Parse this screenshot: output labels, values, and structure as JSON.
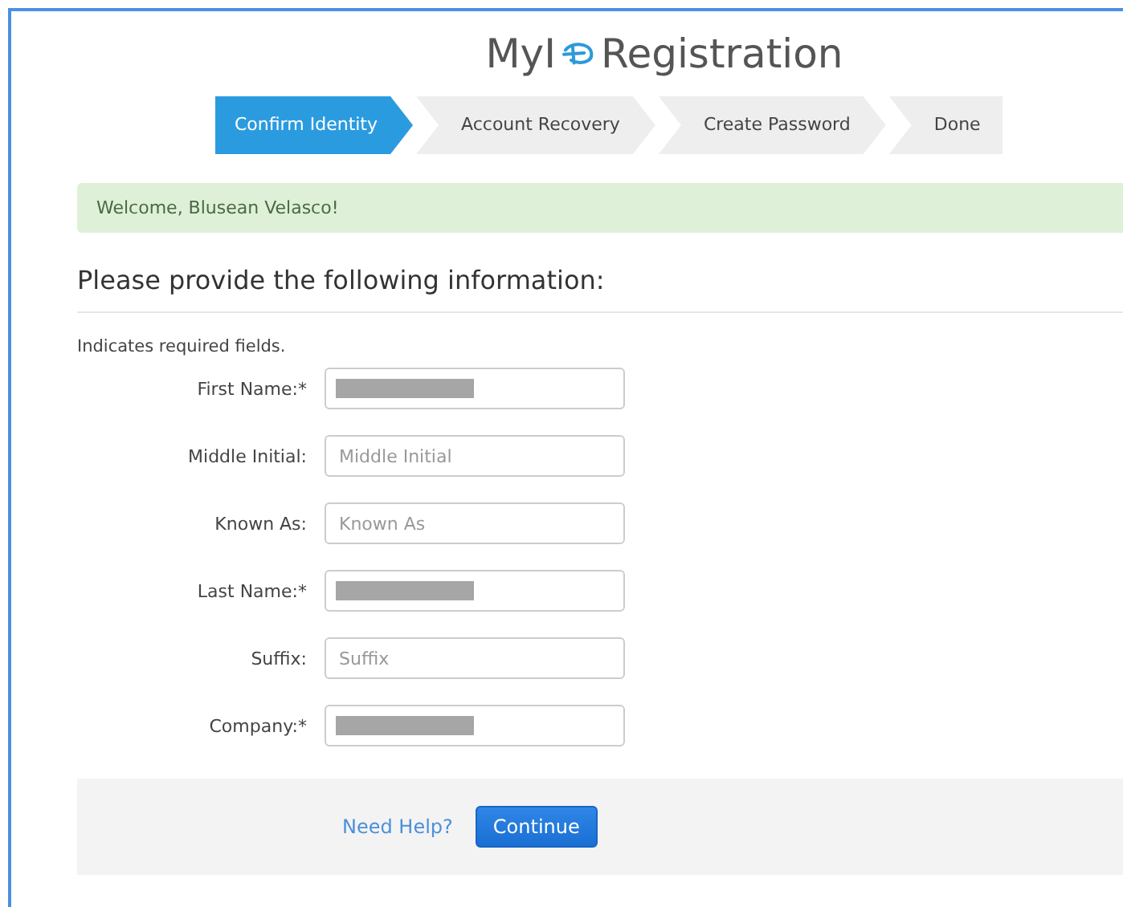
{
  "header": {
    "title_prefix": "MyI",
    "title_suffix": "Registration"
  },
  "steps": [
    {
      "label": "Confirm Identity",
      "selected": true
    },
    {
      "label": "Account Recovery",
      "selected": false
    },
    {
      "label": "Create Password",
      "selected": false
    },
    {
      "label": "Done",
      "selected": false
    }
  ],
  "alert": {
    "text": "Welcome, Blusean Velasco!"
  },
  "form": {
    "heading": "Please provide the following information:",
    "note": "Indicates required fields.",
    "fields": [
      {
        "label": "First Name:*",
        "kind": "redacted"
      },
      {
        "label": "Middle Initial:",
        "kind": "empty",
        "placeholder": "Middle Initial"
      },
      {
        "label": "Known As:",
        "kind": "empty",
        "placeholder": "Known As"
      },
      {
        "label": "Last Name:*",
        "kind": "redacted"
      },
      {
        "label": "Suffix:",
        "kind": "empty",
        "placeholder": "Suffix"
      },
      {
        "label": "Company:*",
        "kind": "redacted"
      }
    ]
  },
  "footer": {
    "help_link": "Need Help?",
    "button": "Continue"
  }
}
